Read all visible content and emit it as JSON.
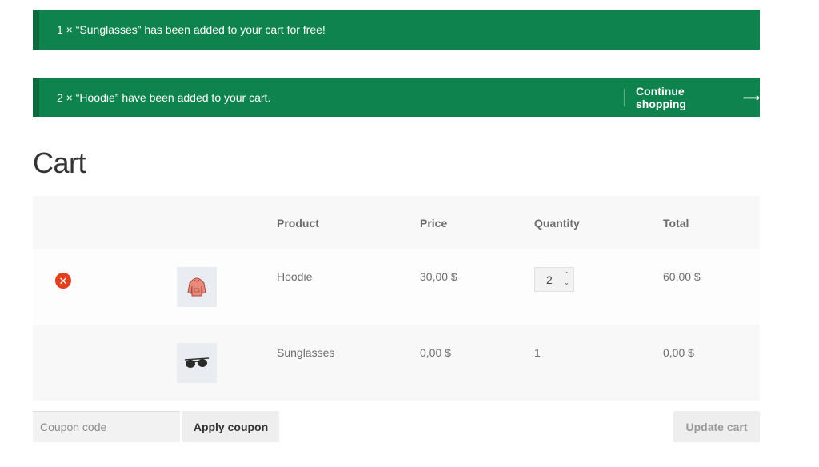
{
  "notices": {
    "free_item": "1 × “Sunglasses” has been added to your cart for free!",
    "added": "2 × “Hoodie” have been added to your cart.",
    "continue_label": "Continue shopping",
    "continue_arrow": "⟶"
  },
  "page": {
    "title": "Cart"
  },
  "table": {
    "headers": {
      "product": "Product",
      "price": "Price",
      "quantity": "Quantity",
      "total": "Total"
    },
    "rows": [
      {
        "name": "Hoodie",
        "price": "30,00 $",
        "quantity": "2",
        "total": "60,00 $",
        "removable": true
      },
      {
        "name": "Sunglasses",
        "price": "0,00 $",
        "quantity": "1",
        "total": "0,00 $",
        "removable": false
      }
    ]
  },
  "actions": {
    "coupon_placeholder": "Coupon code",
    "apply_label": "Apply coupon",
    "update_label": "Update cart"
  },
  "colors": {
    "notice_bg": "#0f834d",
    "link": "#96588a",
    "remove": "#e2401c"
  },
  "icons": {
    "remove": "remove-icon",
    "continue": "arrow-right-icon"
  }
}
